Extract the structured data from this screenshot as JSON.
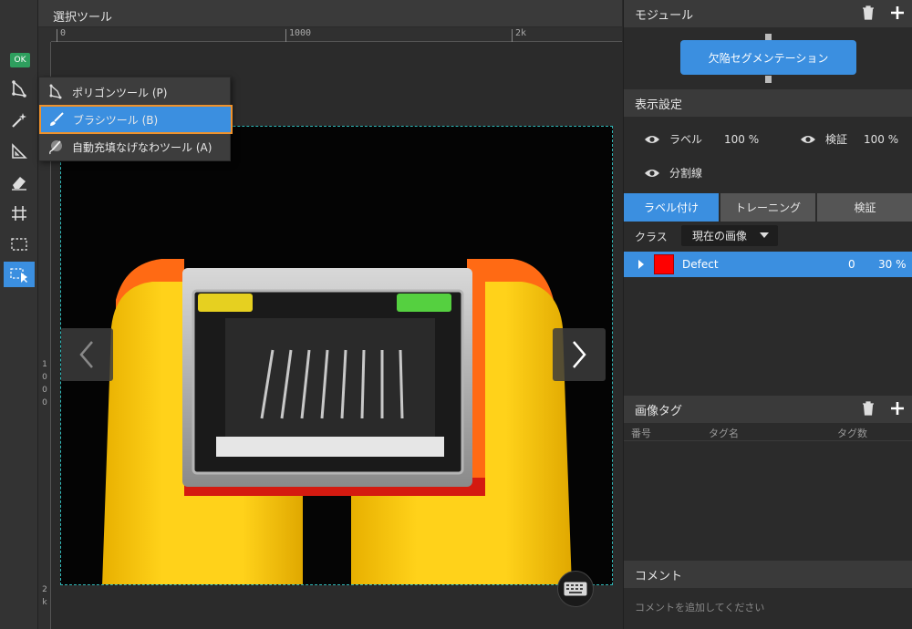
{
  "canvas": {
    "title": "選択ツール",
    "ruler_top": [
      "0",
      "1000",
      "2k"
    ],
    "ruler_left": [
      "1",
      "0",
      "0",
      "0",
      "2",
      "k"
    ]
  },
  "toolbar": {
    "ok_label": "OK",
    "tools": [
      "polygon-tool-icon",
      "magic-wand-icon",
      "ruler-triangle-icon",
      "eraser-icon",
      "crop-icon",
      "dashed-select-icon",
      "select-move-icon"
    ]
  },
  "tool_menu": {
    "items": [
      {
        "label": "ポリゴンツール (P)",
        "icon": "polygon-tool-icon"
      },
      {
        "label": "ブラシツール (B)",
        "icon": "brush-icon",
        "selected": true
      },
      {
        "label": "自動充填なげなわツール (A)",
        "icon": "auto-lasso-icon"
      }
    ]
  },
  "module": {
    "header": "モジュール",
    "button_label": "欠陥セグメンテーション"
  },
  "display": {
    "header": "表示設定",
    "label_text": "ラベル",
    "label_pct": "100 %",
    "verify_text": "検証",
    "verify_pct": "100 %",
    "divider_text": "分割線"
  },
  "tabs": [
    {
      "label": "ラベル付け",
      "active": true
    },
    {
      "label": "トレーニング",
      "active": false
    },
    {
      "label": "検証",
      "active": false
    }
  ],
  "class": {
    "label": "クラス",
    "select_value": "現在の画像",
    "rows": [
      {
        "name": "Defect",
        "count": "0",
        "percent": "30 %",
        "color": "#ff0000"
      }
    ]
  },
  "image_tags": {
    "header": "画像タグ",
    "columns": [
      "番号",
      "タグ名",
      "タグ数"
    ]
  },
  "comment": {
    "header": "コメント",
    "placeholder": "コメントを追加してください"
  },
  "colors": {
    "accent": "#3b8fe0",
    "highlight_outline": "#f0922b",
    "ok_green": "#2e9f5e"
  }
}
